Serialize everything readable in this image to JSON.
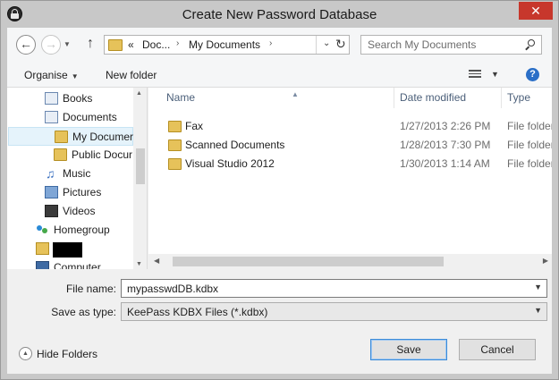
{
  "window": {
    "title": "Create New Password Database",
    "close_glyph": "✕"
  },
  "nav": {
    "back_glyph": "←",
    "forward_glyph": "→",
    "up_glyph": "↑",
    "recent_glyph": "▼"
  },
  "address": {
    "overflow": "«",
    "crumbs": [
      "Doc...",
      "My Documents"
    ],
    "chevron": "›",
    "dropdown_glyph": "⌄",
    "refresh_glyph": "↻"
  },
  "search": {
    "placeholder": "Search My Documents"
  },
  "toolbar": {
    "organise_label": "Organise",
    "new_folder_label": "New folder",
    "help_glyph": "?"
  },
  "nav_tree": {
    "items": [
      {
        "label": "Books",
        "icon": "doc-icon"
      },
      {
        "label": "Documents",
        "icon": "doc-icon"
      },
      {
        "label": "My Documer",
        "icon": "folder-icon"
      },
      {
        "label": "Public Docur",
        "icon": "folder-icon"
      },
      {
        "label": "Music",
        "icon": "music-icon"
      },
      {
        "label": "Pictures",
        "icon": "pictures-icon"
      },
      {
        "label": "Videos",
        "icon": "videos-icon"
      },
      {
        "label": "Homegroup",
        "icon": "homegroup-icon"
      },
      {
        "label": "Computer",
        "icon": "computer-icon"
      }
    ]
  },
  "file_list": {
    "columns": [
      "Name",
      "Date modified",
      "Type"
    ],
    "rows": [
      {
        "name": "Fax",
        "date": "1/27/2013 2:26 PM",
        "type": "File folder"
      },
      {
        "name": "Scanned Documents",
        "date": "1/28/2013 7:30 PM",
        "type": "File folder"
      },
      {
        "name": "Visual Studio 2012",
        "date": "1/30/2013 1:14 AM",
        "type": "File folder"
      }
    ]
  },
  "form": {
    "file_name_label": "File name:",
    "file_name_value": "mypasswdDB.kdbx",
    "save_type_label": "Save as type:",
    "save_type_value": "KeePass KDBX Files (*.kdbx)"
  },
  "footer": {
    "hide_folders_label": "Hide Folders",
    "save_label": "Save",
    "cancel_label": "Cancel"
  },
  "colors": {
    "close_button": "#c7372c",
    "selection": "#e5f3fb",
    "folder": "#e6c25a",
    "primary_button_border": "#3c8bd8"
  }
}
